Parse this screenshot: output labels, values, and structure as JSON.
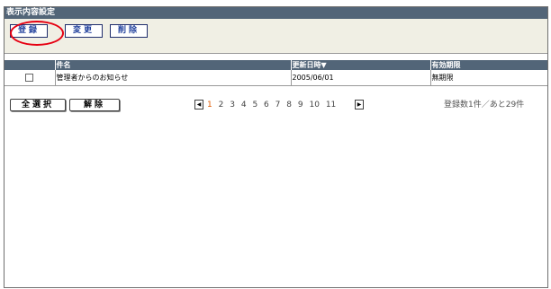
{
  "window": {
    "title": "表示内容設定"
  },
  "toolbar": {
    "register_label": "登録",
    "edit_label": "変更",
    "delete_label": "削除"
  },
  "table": {
    "headers": {
      "subject": "件名",
      "updated": "更新日時▼",
      "expiry": "有効期限"
    },
    "rows": [
      {
        "checked": false,
        "subject": "管理者からのお知らせ",
        "updated": "2005/06/01",
        "expiry": "無期限"
      }
    ]
  },
  "footer": {
    "select_all_label": "全選択",
    "deselect_label": "解除",
    "prev_icon": "◀",
    "next_icon": "▶",
    "pages": [
      "1",
      "2",
      "3",
      "4",
      "5",
      "6",
      "7",
      "8",
      "9",
      "10",
      "11"
    ],
    "current_page": "1",
    "count_text": "登録数1件／あと29件"
  },
  "colors": {
    "title_bar": "#526578",
    "toolbar_bg": "#f0efe4",
    "highlight_oval": "#e60012",
    "current_page": "#e05a00"
  }
}
